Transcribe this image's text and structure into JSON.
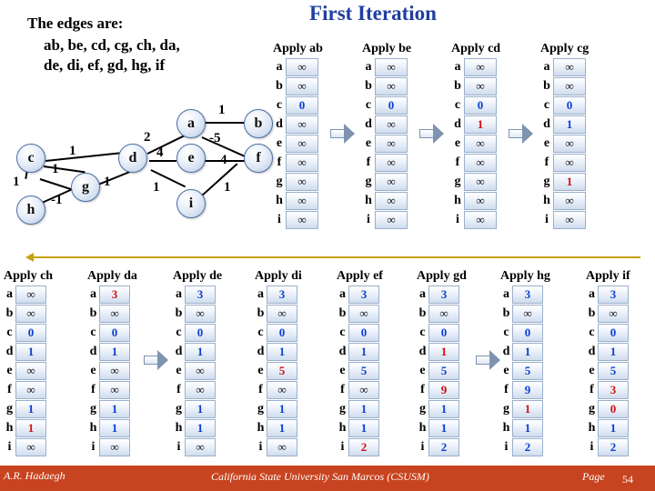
{
  "title": "First Iteration",
  "edges": {
    "heading": "The edges are:",
    "line1": "ab, be, cd, cg, ch, da,",
    "line2": "de, di, ef, gd, hg, if"
  },
  "graph": {
    "nodes": [
      {
        "id": "a",
        "label": "a"
      },
      {
        "id": "b",
        "label": "b"
      },
      {
        "id": "c",
        "label": "c"
      },
      {
        "id": "d",
        "label": "d"
      },
      {
        "id": "e",
        "label": "e"
      },
      {
        "id": "f",
        "label": "f"
      },
      {
        "id": "g",
        "label": "g"
      },
      {
        "id": "h",
        "label": "h"
      },
      {
        "id": "i",
        "label": "i"
      }
    ],
    "weights": [
      {
        "edge": "ab",
        "label": "1"
      },
      {
        "edge": "be",
        "label": "-5"
      },
      {
        "edge": "cd",
        "label": "2"
      },
      {
        "edge": "cg",
        "label": "1"
      },
      {
        "edge": "ch",
        "label": "1"
      },
      {
        "edge": "da",
        "label": "4"
      },
      {
        "edge": "de",
        "label": "4"
      },
      {
        "edge": "di",
        "label": "1"
      },
      {
        "edge": "ef",
        "label": "4"
      },
      {
        "edge": "gd",
        "label": "1"
      },
      {
        "edge": "hg",
        "label": "-1"
      },
      {
        "edge": "if",
        "label": "1"
      },
      {
        "edge": "ha",
        "label": "1"
      }
    ]
  },
  "row_labels": [
    "a",
    "b",
    "c",
    "d",
    "e",
    "f",
    "g",
    "h",
    "i"
  ],
  "tables_top": [
    {
      "caption": "Apply ab",
      "values": [
        "∞",
        "∞",
        "0",
        "∞",
        "∞",
        "∞",
        "∞",
        "∞",
        "∞"
      ],
      "highlight": [
        false,
        false,
        true,
        false,
        false,
        false,
        false,
        false,
        false
      ]
    },
    {
      "caption": "Apply be",
      "values": [
        "∞",
        "∞",
        "0",
        "∞",
        "∞",
        "∞",
        "∞",
        "∞",
        "∞"
      ],
      "highlight": [
        false,
        false,
        true,
        false,
        false,
        false,
        false,
        false,
        false
      ]
    },
    {
      "caption": "Apply cd",
      "values": [
        "∞",
        "∞",
        "0",
        "1",
        "∞",
        "∞",
        "∞",
        "∞",
        "∞"
      ],
      "highlight": [
        false,
        false,
        true,
        true,
        false,
        false,
        false,
        false,
        false
      ]
    },
    {
      "caption": "Apply cg",
      "values": [
        "∞",
        "∞",
        "0",
        "1",
        "∞",
        "∞",
        "1",
        "∞",
        "∞"
      ],
      "highlight": [
        false,
        false,
        true,
        true,
        false,
        false,
        true,
        false,
        false
      ]
    }
  ],
  "tables_bottom": [
    {
      "caption": "Apply ch",
      "values": [
        "∞",
        "∞",
        "0",
        "1",
        "∞",
        "∞",
        "1",
        "1",
        "∞"
      ],
      "red": [
        false,
        false,
        false,
        false,
        false,
        false,
        false,
        true,
        false
      ]
    },
    {
      "caption": "Apply da",
      "values": [
        "3",
        "∞",
        "0",
        "1",
        "∞",
        "∞",
        "1",
        "1",
        "∞"
      ],
      "red": [
        true,
        false,
        false,
        false,
        false,
        false,
        false,
        false,
        false
      ]
    },
    {
      "caption": "Apply de",
      "values": [
        "3",
        "∞",
        "0",
        "1",
        "∞",
        "∞",
        "1",
        "1",
        "∞"
      ],
      "red": [
        false,
        false,
        false,
        false,
        false,
        false,
        false,
        false,
        false
      ]
    },
    {
      "caption": "Apply di",
      "values": [
        "3",
        "∞",
        "0",
        "1",
        "5",
        "∞",
        "1",
        "1",
        "∞"
      ],
      "red": [
        false,
        false,
        false,
        false,
        true,
        false,
        false,
        false,
        false
      ]
    },
    {
      "caption": "Apply ef",
      "values": [
        "3",
        "∞",
        "0",
        "1",
        "5",
        "∞",
        "1",
        "1",
        "2"
      ],
      "red": [
        false,
        false,
        false,
        false,
        false,
        false,
        false,
        false,
        true
      ]
    },
    {
      "caption": "Apply gd",
      "values": [
        "3",
        "∞",
        "0",
        "1",
        "5",
        "9",
        "1",
        "1",
        "2"
      ],
      "red": [
        false,
        false,
        false,
        true,
        false,
        true,
        false,
        false,
        false
      ]
    },
    {
      "caption": "Apply hg",
      "values": [
        "3",
        "∞",
        "0",
        "1",
        "5",
        "9",
        "1",
        "1",
        "2"
      ],
      "red": [
        false,
        false,
        false,
        false,
        false,
        false,
        true,
        false,
        false
      ]
    },
    {
      "caption": "Apply if",
      "values": [
        "3",
        "∞",
        "0",
        "1",
        "5",
        "3",
        "0",
        "1",
        "2"
      ],
      "red": [
        false,
        false,
        false,
        false,
        false,
        true,
        true,
        false,
        false
      ]
    }
  ],
  "footer": {
    "left": "A.R. Hadaegh",
    "center": "California State University San Marcos (CSUSM)",
    "right": "Page",
    "page": "54"
  }
}
